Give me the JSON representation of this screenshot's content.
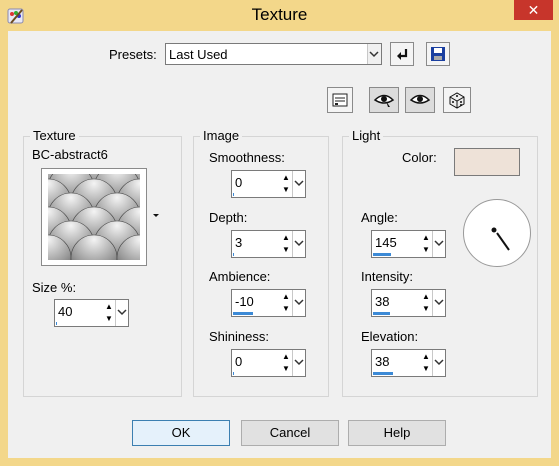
{
  "window": {
    "title": "Texture",
    "close_glyph": "✕"
  },
  "presets": {
    "label": "Presets:",
    "value": "Last Used"
  },
  "texture": {
    "group_title": "Texture",
    "name": "BC-abstract6",
    "size_label": "Size %:",
    "size_value": "40",
    "size_fraction": 0.03
  },
  "image": {
    "group_title": "Image",
    "smoothness_label": "Smoothness:",
    "smoothness_value": "0",
    "smoothness_fraction": 0,
    "depth_label": "Depth:",
    "depth_value": "3",
    "depth_fraction": 0.02,
    "ambience_label": "Ambience:",
    "ambience_value": "-10",
    "ambience_fraction": 0.45,
    "shininess_label": "Shininess:",
    "shininess_value": "0",
    "shininess_fraction": 0
  },
  "light": {
    "group_title": "Light",
    "color_label": "Color:",
    "color_hex": "#eee2d8",
    "angle_label": "Angle:",
    "angle_value": "145",
    "angle_fraction": 0.4,
    "intensity_label": "Intensity:",
    "intensity_value": "38",
    "intensity_fraction": 0.38,
    "elevation_label": "Elevation:",
    "elevation_value": "38",
    "elevation_fraction": 0.45
  },
  "buttons": {
    "ok": "OK",
    "cancel": "Cancel",
    "help": "Help"
  },
  "icons": [
    "app-icon",
    "close-icon",
    "reset-icon",
    "save-icon",
    "options-icon",
    "proof-icon",
    "preview-icon",
    "randomize-icon",
    "angle-dial"
  ]
}
